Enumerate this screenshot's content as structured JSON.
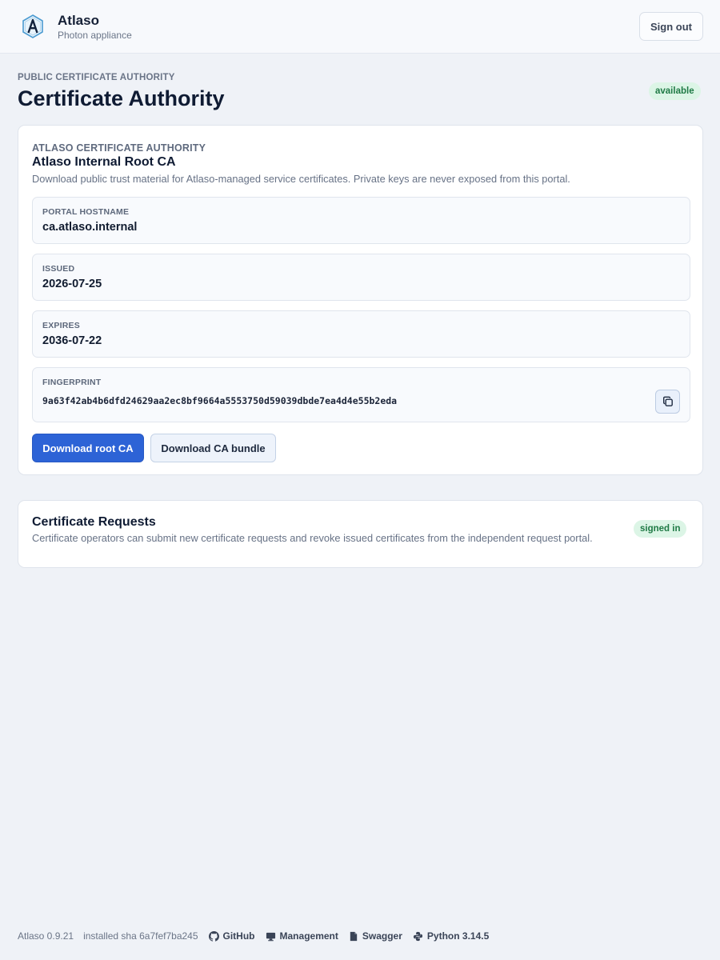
{
  "header": {
    "app_name": "Atlaso",
    "app_subtitle": "Photon appliance",
    "sign_out_label": "Sign out",
    "logo_icon": "atlaso-hexagon-logo"
  },
  "page": {
    "eyebrow": "PUBLIC CERTIFICATE AUTHORITY",
    "title": "Certificate Authority",
    "status": "available"
  },
  "ca_card": {
    "eyebrow": "ATLASO CERTIFICATE AUTHORITY",
    "title": "Atlaso Internal Root CA",
    "description": "Download public trust material for Atlaso-managed service certificates. Private keys are never exposed from this portal.",
    "fields": [
      {
        "label": "PORTAL HOSTNAME",
        "value": "ca.atlaso.internal"
      },
      {
        "label": "ISSUED",
        "value": "2026-07-25"
      },
      {
        "label": "EXPIRES",
        "value": "2036-07-22"
      },
      {
        "label": "FINGERPRINT",
        "value": "9a63f42ab4b6dfd24629aa2ec8bf9664a5553750d59039dbde7ea4d4e55b2eda"
      }
    ],
    "copy_icon": "copy-icon",
    "download_root_label": "Download root CA",
    "download_bundle_label": "Download CA bundle"
  },
  "requests_card": {
    "title": "Certificate Requests",
    "description": "Certificate operators can submit new certificate requests and revoke issued certificates from the independent request portal.",
    "status": "signed in"
  },
  "footer": {
    "version": "Atlaso 0.9.21",
    "installed_sha": "installed sha 6a7fef7ba245",
    "links": [
      {
        "label": "GitHub",
        "icon": "github-icon"
      },
      {
        "label": "Management",
        "icon": "monitor-icon"
      },
      {
        "label": "Swagger",
        "icon": "document-icon"
      },
      {
        "label": "Python 3.14.5",
        "icon": "python-icon"
      }
    ]
  },
  "colors": {
    "accent": "#2d63d6",
    "background": "#eff2f7",
    "status_bg": "#dcf5e6",
    "status_text": "#1f7a45"
  }
}
